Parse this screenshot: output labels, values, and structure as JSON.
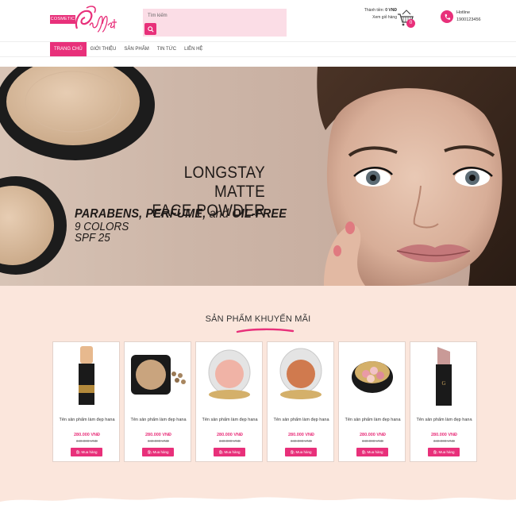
{
  "header": {
    "logo_badge": "COSMETIC",
    "logo_script": "Buffet",
    "search_placeholder": "Tìm kiếm",
    "cart_total_label": "Thành tiền:",
    "cart_total_value": "0 VNĐ",
    "cart_view_label": "Xem giỏ hàng",
    "cart_count": "0",
    "hotline_label": "Hotline",
    "hotline_number": "1900123456"
  },
  "nav": {
    "items": [
      "TRANG CHỦ",
      "GIỚI THIỆU",
      "SẢN PHẨM",
      "TIN TỨC",
      "LIÊN HỆ"
    ],
    "active_index": 0
  },
  "banner": {
    "title_line1": "LONGSTAY MATTE",
    "title_line2": "FACE POWDER",
    "sub_part1": "PARABENS, PERFUME,",
    "sub_and": "and",
    "sub_part2": "OIL-FREE",
    "line2": "9 COLORS",
    "line3": "SPF 25"
  },
  "promo": {
    "title": "SẢN PHẨM KHUYẾN MÃI",
    "products": [
      {
        "name": "Tên sản phẩm làm đẹp hana",
        "price": "280.000 VNĐ",
        "old_price": "340.000 VNĐ",
        "buy_label": "Mua hàng"
      },
      {
        "name": "Tên sản phẩm làm đẹp hana",
        "price": "280.000 VNĐ",
        "old_price": "340.000 VNĐ",
        "buy_label": "Mua hàng"
      },
      {
        "name": "Tên sản phẩm làm đẹp hana",
        "price": "280.000 VNĐ",
        "old_price": "340.000 VNĐ",
        "buy_label": "Mua hàng"
      },
      {
        "name": "Tên sản phẩm làm đẹp hana",
        "price": "280.000 VNĐ",
        "old_price": "340.000 VNĐ",
        "buy_label": "Mua hàng"
      },
      {
        "name": "Tên sản phẩm làm đẹp hana",
        "price": "280.000 VNĐ",
        "old_price": "340.000 VNĐ",
        "buy_label": "Mua hàng"
      },
      {
        "name": "Tên sản phẩm làm đẹp hana",
        "price": "280.000 VNĐ",
        "old_price": "340.000 VNĐ",
        "buy_label": "Mua hàng"
      }
    ]
  },
  "colors": {
    "accent": "#e8307a",
    "search_bg": "#fbdde6",
    "promo_bg": "#fbe6dc"
  },
  "icons": [
    "search-icon",
    "cart-icon",
    "phone-icon",
    "shopping-bag-icon",
    "chevron-left-icon",
    "chevron-right-icon"
  ]
}
